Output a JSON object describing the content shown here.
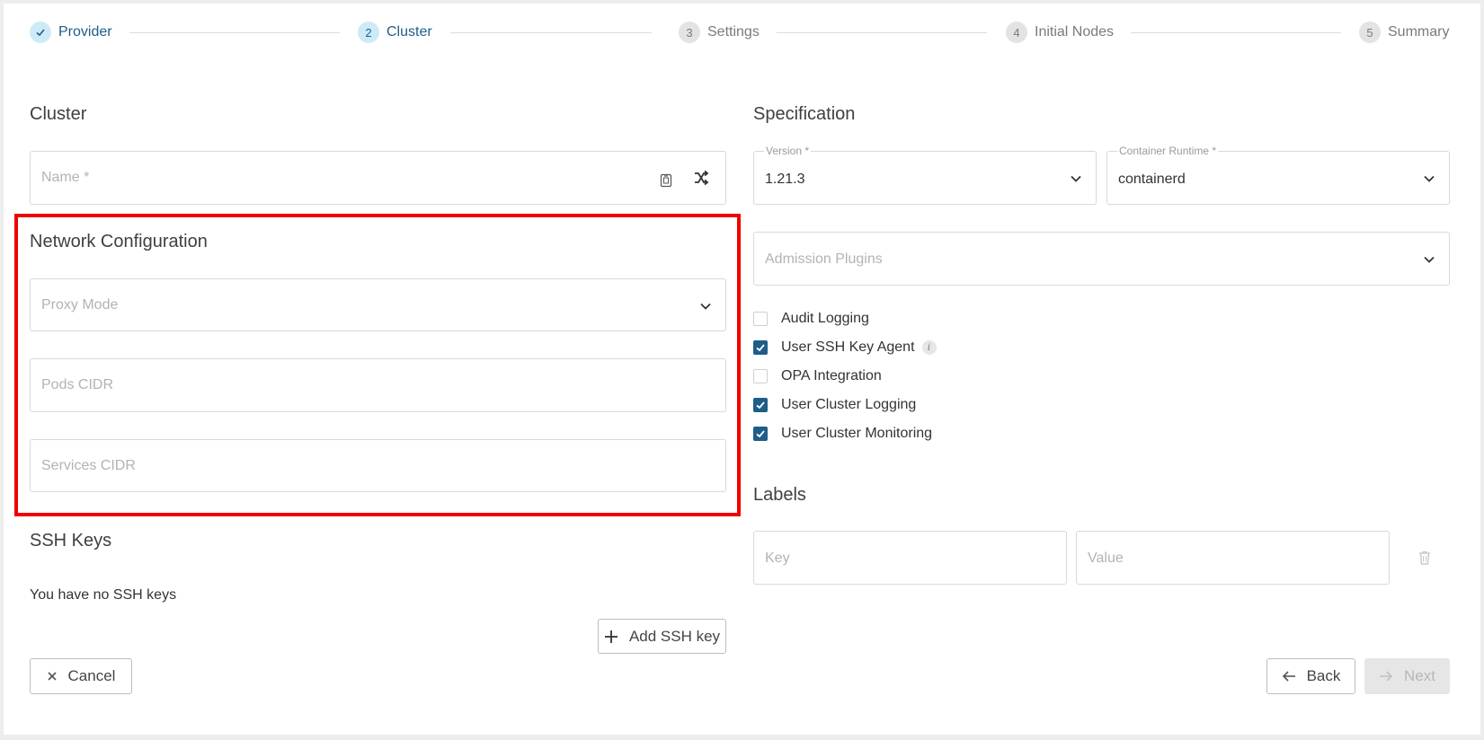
{
  "stepper": {
    "steps": [
      {
        "number": "✓",
        "label": "Provider",
        "state": "complete"
      },
      {
        "number": "2",
        "label": "Cluster",
        "state": "active"
      },
      {
        "number": "3",
        "label": "Settings",
        "state": "inactive"
      },
      {
        "number": "4",
        "label": "Initial Nodes",
        "state": "inactive"
      },
      {
        "number": "5",
        "label": "Summary",
        "state": "inactive"
      }
    ]
  },
  "cluster": {
    "title": "Cluster",
    "name_placeholder": "Name *"
  },
  "network": {
    "title": "Network Configuration",
    "proxy_mode_placeholder": "Proxy Mode",
    "pods_cidr_placeholder": "Pods CIDR",
    "services_cidr_placeholder": "Services CIDR"
  },
  "ssh": {
    "title": "SSH Keys",
    "empty_text": "You have no SSH keys",
    "add_label": "Add SSH key"
  },
  "spec": {
    "title": "Specification",
    "version_label": "Version *",
    "version_value": "1.21.3",
    "runtime_label": "Container Runtime *",
    "runtime_value": "containerd",
    "admission_placeholder": "Admission Plugins",
    "checkboxes": [
      {
        "label": "Audit Logging",
        "checked": false
      },
      {
        "label": "User SSH Key Agent",
        "checked": true
      },
      {
        "label": "OPA Integration",
        "checked": false
      },
      {
        "label": "User Cluster Logging",
        "checked": true
      },
      {
        "label": "User Cluster Monitoring",
        "checked": true
      }
    ]
  },
  "labels": {
    "title": "Labels",
    "key_placeholder": "Key",
    "value_placeholder": "Value"
  },
  "footer": {
    "cancel_label": "Cancel",
    "back_label": "Back",
    "next_label": "Next"
  },
  "colors": {
    "accent": "#1e5d87",
    "highlight": "#ee0000"
  }
}
